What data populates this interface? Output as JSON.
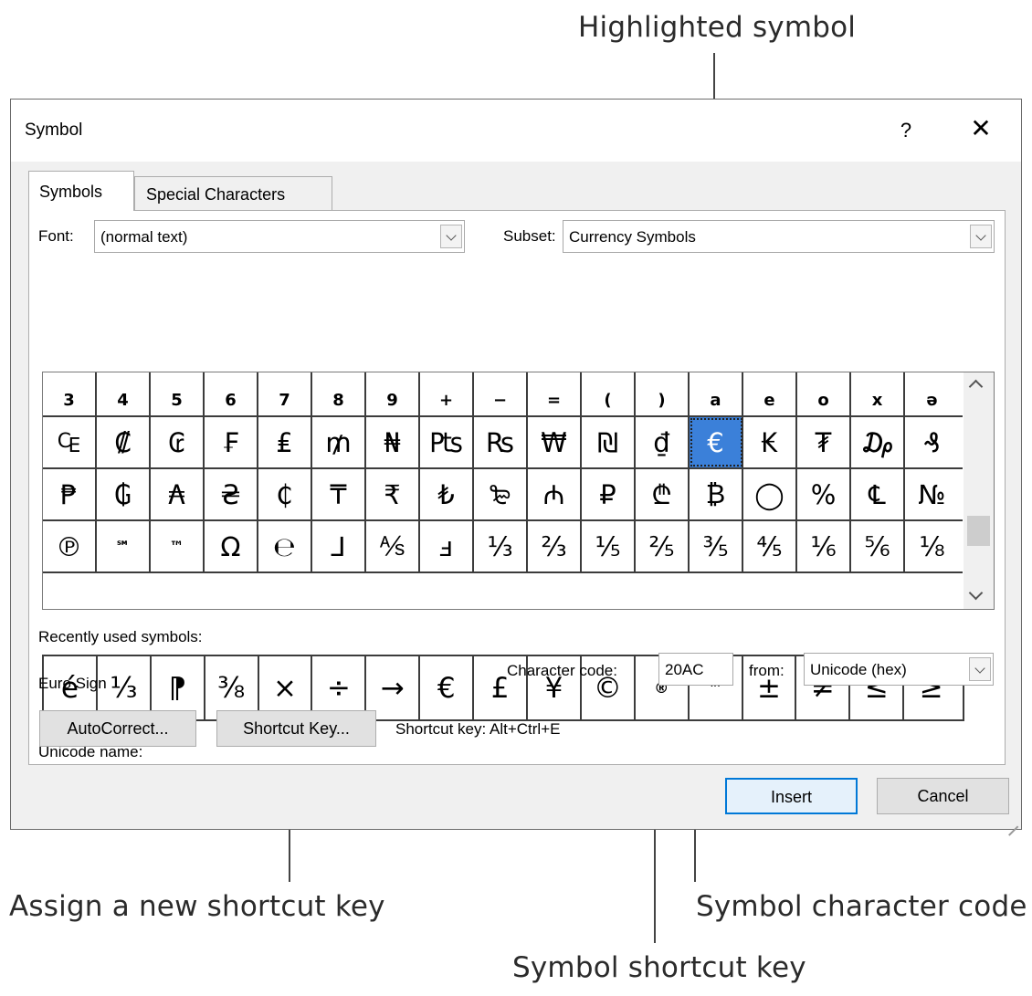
{
  "callouts": {
    "highlighted_symbol": "Highlighted symbol",
    "assign_shortcut": "Assign a new shortcut key",
    "character_code": "Symbol character code",
    "shortcut_key": "Symbol shortcut key"
  },
  "dialog": {
    "title": "Symbol",
    "help_label": "?",
    "close_label": "✕",
    "tabs": [
      {
        "label": "Symbols",
        "active": true
      },
      {
        "label": "Special Characters",
        "active": false
      }
    ],
    "font_label": "Font:",
    "font_value": "(normal text)",
    "subset_label": "Subset:",
    "subset_value": "Currency Symbols",
    "grid": {
      "rows": [
        [
          "3",
          "4",
          "5",
          "6",
          "7",
          "8",
          "9",
          "+",
          "−",
          "=",
          "(",
          ")",
          "a",
          "e",
          "o",
          "x",
          "ə"
        ],
        [
          "₠",
          "₡",
          "₢",
          "₣",
          "₤",
          "₥",
          "₦",
          "₧",
          "₨",
          "₩",
          "₪",
          "₫",
          "€",
          "₭",
          "₮",
          "₯",
          "₰"
        ],
        [
          "₱",
          "₲",
          "₳",
          "₴",
          "₵",
          "₸",
          "₹",
          "₺",
          "₻",
          "₼",
          "₽",
          "₾",
          "₿",
          "◯",
          "%",
          "℄",
          "№"
        ],
        [
          "℗",
          "℠",
          "™",
          "Ω",
          "℮",
          "⅃",
          "⅍",
          "ⅎ",
          "⅓",
          "⅔",
          "⅕",
          "⅖",
          "⅗",
          "⅘",
          "⅙",
          "⅚",
          "⅛"
        ]
      ],
      "selected": "€",
      "accent": "#3b80d9"
    },
    "recent_label": "Recently used symbols:",
    "recent": [
      "é",
      "⅓",
      "⁋",
      "⅜",
      "×",
      "÷",
      "→",
      "€",
      "£",
      "¥",
      "©",
      "®",
      "™",
      "±",
      "≠",
      "≤",
      "≥"
    ],
    "unicode_name_label": "Unicode name:",
    "unicode_name_value": "Euro Sign",
    "char_code_label": "Character code:",
    "char_code_value": "20AC",
    "from_label": "from:",
    "from_value": "Unicode (hex)",
    "autocorrect_label": "AutoCorrect...",
    "shortcut_btn_label": "Shortcut Key...",
    "shortcut_text": "Shortcut key: Alt+Ctrl+E",
    "insert_label": "Insert",
    "cancel_label": "Cancel"
  }
}
